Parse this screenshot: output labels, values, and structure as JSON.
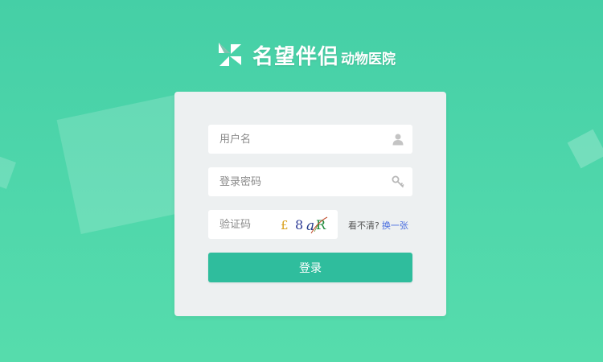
{
  "brand": {
    "name": "名望伴侣",
    "subtitle": "动物医院"
  },
  "form": {
    "username_placeholder": "用户名",
    "password_placeholder": "登录密码",
    "captcha_placeholder": "验证码",
    "captcha_text": "£8aR",
    "captcha_hint": "看不清?",
    "captcha_refresh": "换一张",
    "login_label": "登录"
  },
  "icons": {
    "brand_logo": "pinwheel-logo",
    "username": "user-icon",
    "password": "key-icon"
  },
  "colors": {
    "background": "#4ad3a8",
    "card": "#edf0f1",
    "primary_button": "#2fbd9d",
    "link": "#4a6ee0"
  }
}
